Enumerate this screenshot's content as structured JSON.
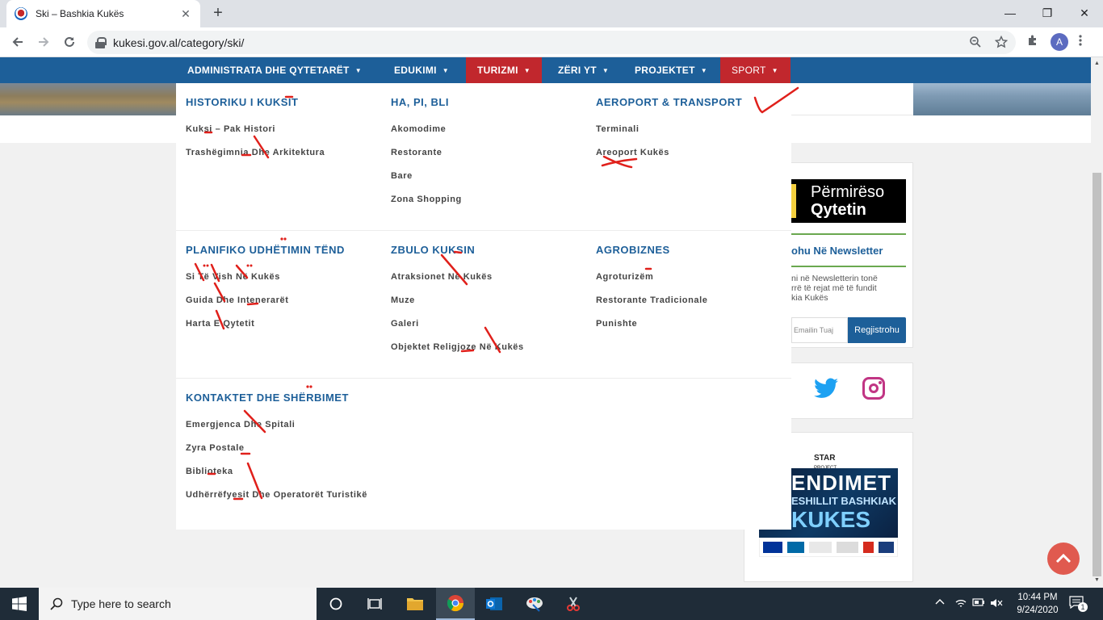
{
  "browser": {
    "tab_title": "Ski – Bashkia Kukës",
    "tab_close": "✕",
    "new_tab": "+",
    "url": "kukesi.gov.al/category/ski/",
    "avatar_letter": "A",
    "window_controls": [
      "—",
      "❐",
      "✕"
    ]
  },
  "nav": {
    "items": [
      {
        "label": "ADMINISTRATA DHE QYTETARËT"
      },
      {
        "label": "EDUKIMI"
      },
      {
        "label": "TURIZMI"
      },
      {
        "label": "ZËRI YT"
      },
      {
        "label": "PROJEKTET"
      },
      {
        "label": "SPORT"
      }
    ],
    "caret": "▼"
  },
  "mega": {
    "sections": [
      {
        "title": "HISTORIKU I KUKSIT",
        "links": [
          "Kuksi – Pak Histori",
          "Trashëgimnia Dhe Arkitektura"
        ]
      },
      {
        "title": "HA, PI, BLI",
        "links": [
          "Akomodime",
          "Restorante",
          "Bare",
          "Zona Shopping"
        ]
      },
      {
        "title": "AEROPORT & TRANSPORT",
        "links": [
          "Terminali",
          "Areoport Kukës"
        ]
      },
      {
        "title": "PLANIFIKO UDHËTIMIN TËND",
        "links": [
          "Si Të Vish Në Kukës",
          "Guida Dhe Intenerarët",
          "Harta E Qytetit"
        ]
      },
      {
        "title": "ZBULO KUKSIN",
        "links": [
          "Atraksionet Në Kukës",
          "Muze",
          "Galeri",
          "Objektet Religjoze Në Kukës"
        ]
      },
      {
        "title": "AGROBIZNES",
        "links": [
          "Agroturizëm",
          "Restorante Tradicionale",
          "Punishte"
        ]
      },
      {
        "title": "KONTAKTET DHE SHËRBIMET",
        "links": [
          "Emergjenca Dhe Spitali",
          "Zyra Postale",
          "Biblioteka",
          "Udhërrëfyesit Dhe Operatorët Turistikë"
        ]
      }
    ]
  },
  "sidebar": {
    "promo_line1": "Përmirëso",
    "promo_line2": "Qytetin",
    "newsletter_title": "ohu Në Newsletter",
    "newsletter_text": "ni në Newsletterin tonë\nrrë të rejat më të fundit\nkia Kukës",
    "email_placeholder": "Emailin Tuaj",
    "subscribe_label": "Regjistrohu",
    "star_logo": "STAR",
    "star_sub": "PROJECT",
    "poster_l1": "ENDIMET",
    "poster_l2": "ESHILLIT BASHKIAK",
    "poster_l3": "KUKES"
  },
  "taskbar": {
    "search_placeholder": "Type here to search",
    "time": "10:44 PM",
    "date": "9/24/2020",
    "notification_count": "1"
  },
  "colors": {
    "nav_blue": "#1d5f99",
    "accent_red": "#c1272d",
    "ink_red": "#e0201b"
  }
}
